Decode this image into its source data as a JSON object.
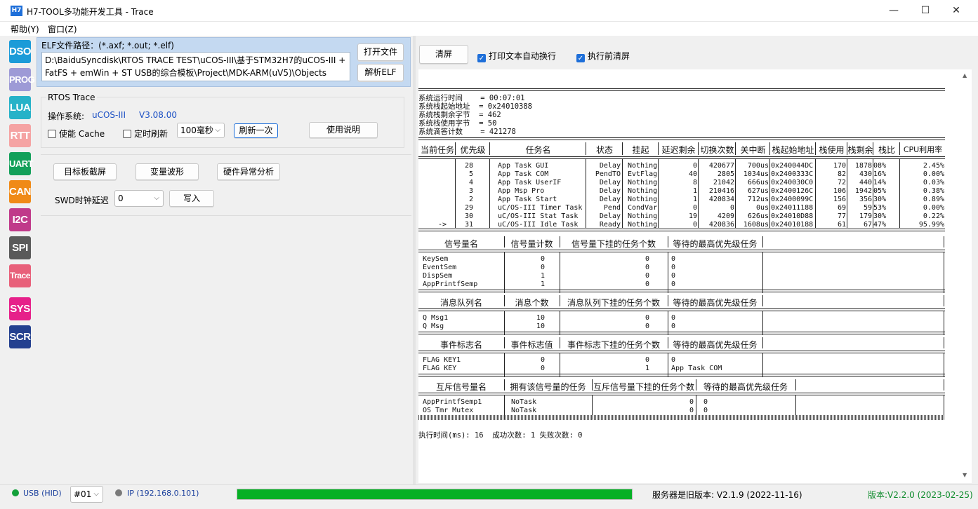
{
  "window": {
    "title": "H7-TOOL多功能开发工具 - Trace",
    "icon_text": "H7",
    "minimize": "—",
    "maximize": "☐",
    "close": "✕"
  },
  "menu": {
    "help": "帮助(Y)",
    "window": "窗口(Z)"
  },
  "modes": [
    {
      "label": "DSO",
      "color": "#1b9bd8"
    },
    {
      "label": "PROG",
      "color": "#9d9ad6"
    },
    {
      "label": "LUA",
      "color": "#26b2c8"
    },
    {
      "label": "RTT",
      "color": "#f5a3a3"
    },
    {
      "label": "UART",
      "color": "#13a05a"
    },
    {
      "label": "CAN",
      "color": "#f08a17"
    },
    {
      "label": "I2C",
      "color": "#c03a8a"
    },
    {
      "label": "SPI",
      "color": "#5a5a5a"
    },
    {
      "label": "Trace",
      "color": "#e8607a"
    },
    {
      "label": "SYS",
      "color": "#e6208a"
    },
    {
      "label": "SCR",
      "color": "#23408f"
    }
  ],
  "elf": {
    "label": "ELF文件路径：(*.axf; *.out; *.elf)",
    "path_line1": "D:\\BaiduSyncdisk\\RTOS TRACE TEST\\uCOS-III\\基于STM32H7的uCOS-III +",
    "path_line2": "FatFS + emWin + ST USB的综合模板\\Project\\MDK-ARM(uV5)\\Objects",
    "open_button": "打开文件",
    "parse_button": "解析ELF"
  },
  "rtos": {
    "group_title": "RTOS Trace",
    "os_label": "操作系统:",
    "os_name": "uCOS-III",
    "os_version": "V3.08.00",
    "cache_checkbox": "使能 Cache",
    "timer_checkbox": "定时刷新",
    "interval_value": "100毫秒",
    "refresh_button": "刷新一次",
    "help_button": "使用说明"
  },
  "tools": {
    "screenshot_button": "目标板截屏",
    "waveform_button": "变量波形",
    "fault_button": "硬件异常分析",
    "swd_label": "SWD时钟延迟",
    "swd_value": "0",
    "write_button": "写入"
  },
  "right_toolbar": {
    "clear_button": "清屏",
    "wrap_checkbox": "打印文本自动换行",
    "clear_before_checkbox": "执行前清屏"
  },
  "system": {
    "lines": [
      "系统运行时间    = 00:07:01",
      "系统栈起始地址  = 0x24010388",
      "系统栈剩余字节  = 462",
      "系统栈使用字节  = 50",
      "系统滴答计数    = 421278"
    ]
  },
  "task_table": {
    "headers": [
      "当前任务",
      "优先级",
      "任务名",
      "状态",
      "挂起",
      "延迟剩余",
      "切换次数",
      "关中断",
      "栈起始地址",
      "栈使用",
      "栈剩余",
      "栈比",
      "CPU利用率"
    ],
    "rows": [
      {
        "cur": "",
        "prio": "28",
        "name": "App Task GUI",
        "state": "Delay",
        "pend": "Nothing",
        "dly": "0",
        "ctx": "420677",
        "cs": "700us",
        "stk": "0x240044DC",
        "used": "170",
        "free": "1878",
        "pct": "08%",
        "cpu": "2.45%"
      },
      {
        "cur": "",
        "prio": "5",
        "name": "App Task COM",
        "state": "PendTO",
        "pend": "EvtFlag",
        "dly": "40",
        "ctx": "2805",
        "cs": "1034us",
        "stk": "0x2400333C",
        "used": "82",
        "free": "430",
        "pct": "16%",
        "cpu": "0.00%"
      },
      {
        "cur": "",
        "prio": "4",
        "name": "App Task UserIF",
        "state": "Delay",
        "pend": "Nothing",
        "dly": "8",
        "ctx": "21042",
        "cs": "666us",
        "stk": "0x240030C0",
        "used": "72",
        "free": "440",
        "pct": "14%",
        "cpu": "0.03%"
      },
      {
        "cur": "",
        "prio": "3",
        "name": "App Msp Pro",
        "state": "Delay",
        "pend": "Nothing",
        "dly": "1",
        "ctx": "210416",
        "cs": "627us",
        "stk": "0x2400126C",
        "used": "106",
        "free": "1942",
        "pct": "05%",
        "cpu": "0.38%"
      },
      {
        "cur": "",
        "prio": "2",
        "name": "App Task Start",
        "state": "Delay",
        "pend": "Nothing",
        "dly": "1",
        "ctx": "420834",
        "cs": "712us",
        "stk": "0x2400099C",
        "used": "156",
        "free": "356",
        "pct": "30%",
        "cpu": "0.89%"
      },
      {
        "cur": "",
        "prio": "29",
        "name": "uC/OS-III Timer Task",
        "state": "Pend",
        "pend": "CondVar",
        "dly": "0",
        "ctx": "0",
        "cs": "0us",
        "stk": "0x24011188",
        "used": "69",
        "free": "59",
        "pct": "53%",
        "cpu": "0.00%"
      },
      {
        "cur": "",
        "prio": "30",
        "name": "uC/OS-III Stat Task",
        "state": "Delay",
        "pend": "Nothing",
        "dly": "19",
        "ctx": "4209",
        "cs": "626us",
        "stk": "0x24010D88",
        "used": "77",
        "free": "179",
        "pct": "30%",
        "cpu": "0.22%"
      },
      {
        "cur": "->",
        "prio": "31",
        "name": "uC/OS-III Idle Task",
        "state": "Ready",
        "pend": "Nothing",
        "dly": "0",
        "ctx": "420836",
        "cs": "1608us",
        "stk": "0x24010188",
        "used": "61",
        "free": "67",
        "pct": "47%",
        "cpu": "95.99%"
      }
    ]
  },
  "sem_table": {
    "headers": [
      "信号量名",
      "信号量计数",
      "信号量下挂的任务个数",
      "等待的最高优先级任务"
    ],
    "rows": [
      {
        "name": "KeySem",
        "count": "0",
        "tasks": "0",
        "top": "0"
      },
      {
        "name": "EventSem",
        "count": "0",
        "tasks": "0",
        "top": "0"
      },
      {
        "name": "DispSem",
        "count": "1",
        "tasks": "0",
        "top": "0"
      },
      {
        "name": "AppPrintfSemp",
        "count": "1",
        "tasks": "0",
        "top": "0"
      }
    ]
  },
  "q_table": {
    "headers": [
      "消息队列名",
      "消息个数",
      "消息队列下挂的任务个数",
      "等待的最高优先级任务"
    ],
    "rows": [
      {
        "name": "Q Msg1",
        "count": "10",
        "tasks": "0",
        "top": "0"
      },
      {
        "name": "Q Msg",
        "count": "10",
        "tasks": "0",
        "top": "0"
      }
    ]
  },
  "flag_table": {
    "headers": [
      "事件标志名",
      "事件标志值",
      "事件标志下挂的任务个数",
      "等待的最高优先级任务"
    ],
    "rows": [
      {
        "name": "FLAG KEY1",
        "count": "0",
        "tasks": "0",
        "top": "0"
      },
      {
        "name": "FLAG KEY",
        "count": "0",
        "tasks": "1",
        "top": "App Task COM"
      }
    ]
  },
  "mutex_table": {
    "headers": [
      "互斥信号量名",
      "拥有该信号量的任务",
      "互斥信号量下挂的任务个数",
      "等待的最高优先级任务"
    ],
    "rows": [
      {
        "name": "AppPrintfSemp1",
        "owner": "NoTask",
        "tasks": "0",
        "top": "0"
      },
      {
        "name": "OS Tmr Mutex",
        "owner": "NoTask",
        "tasks": "0",
        "top": "0"
      }
    ]
  },
  "exec_line": "执行时间(ms): 16  成功次数: 1 失败次数: 0",
  "status": {
    "usb": "USB (HID)",
    "device": "#01",
    "ip": "IP (192.168.0.101)",
    "progress": 1.0,
    "server": "服务器是旧版本: V2.1.9 (2022-11-16)",
    "version": "版本:V2.2.0 (2023-02-25)"
  }
}
